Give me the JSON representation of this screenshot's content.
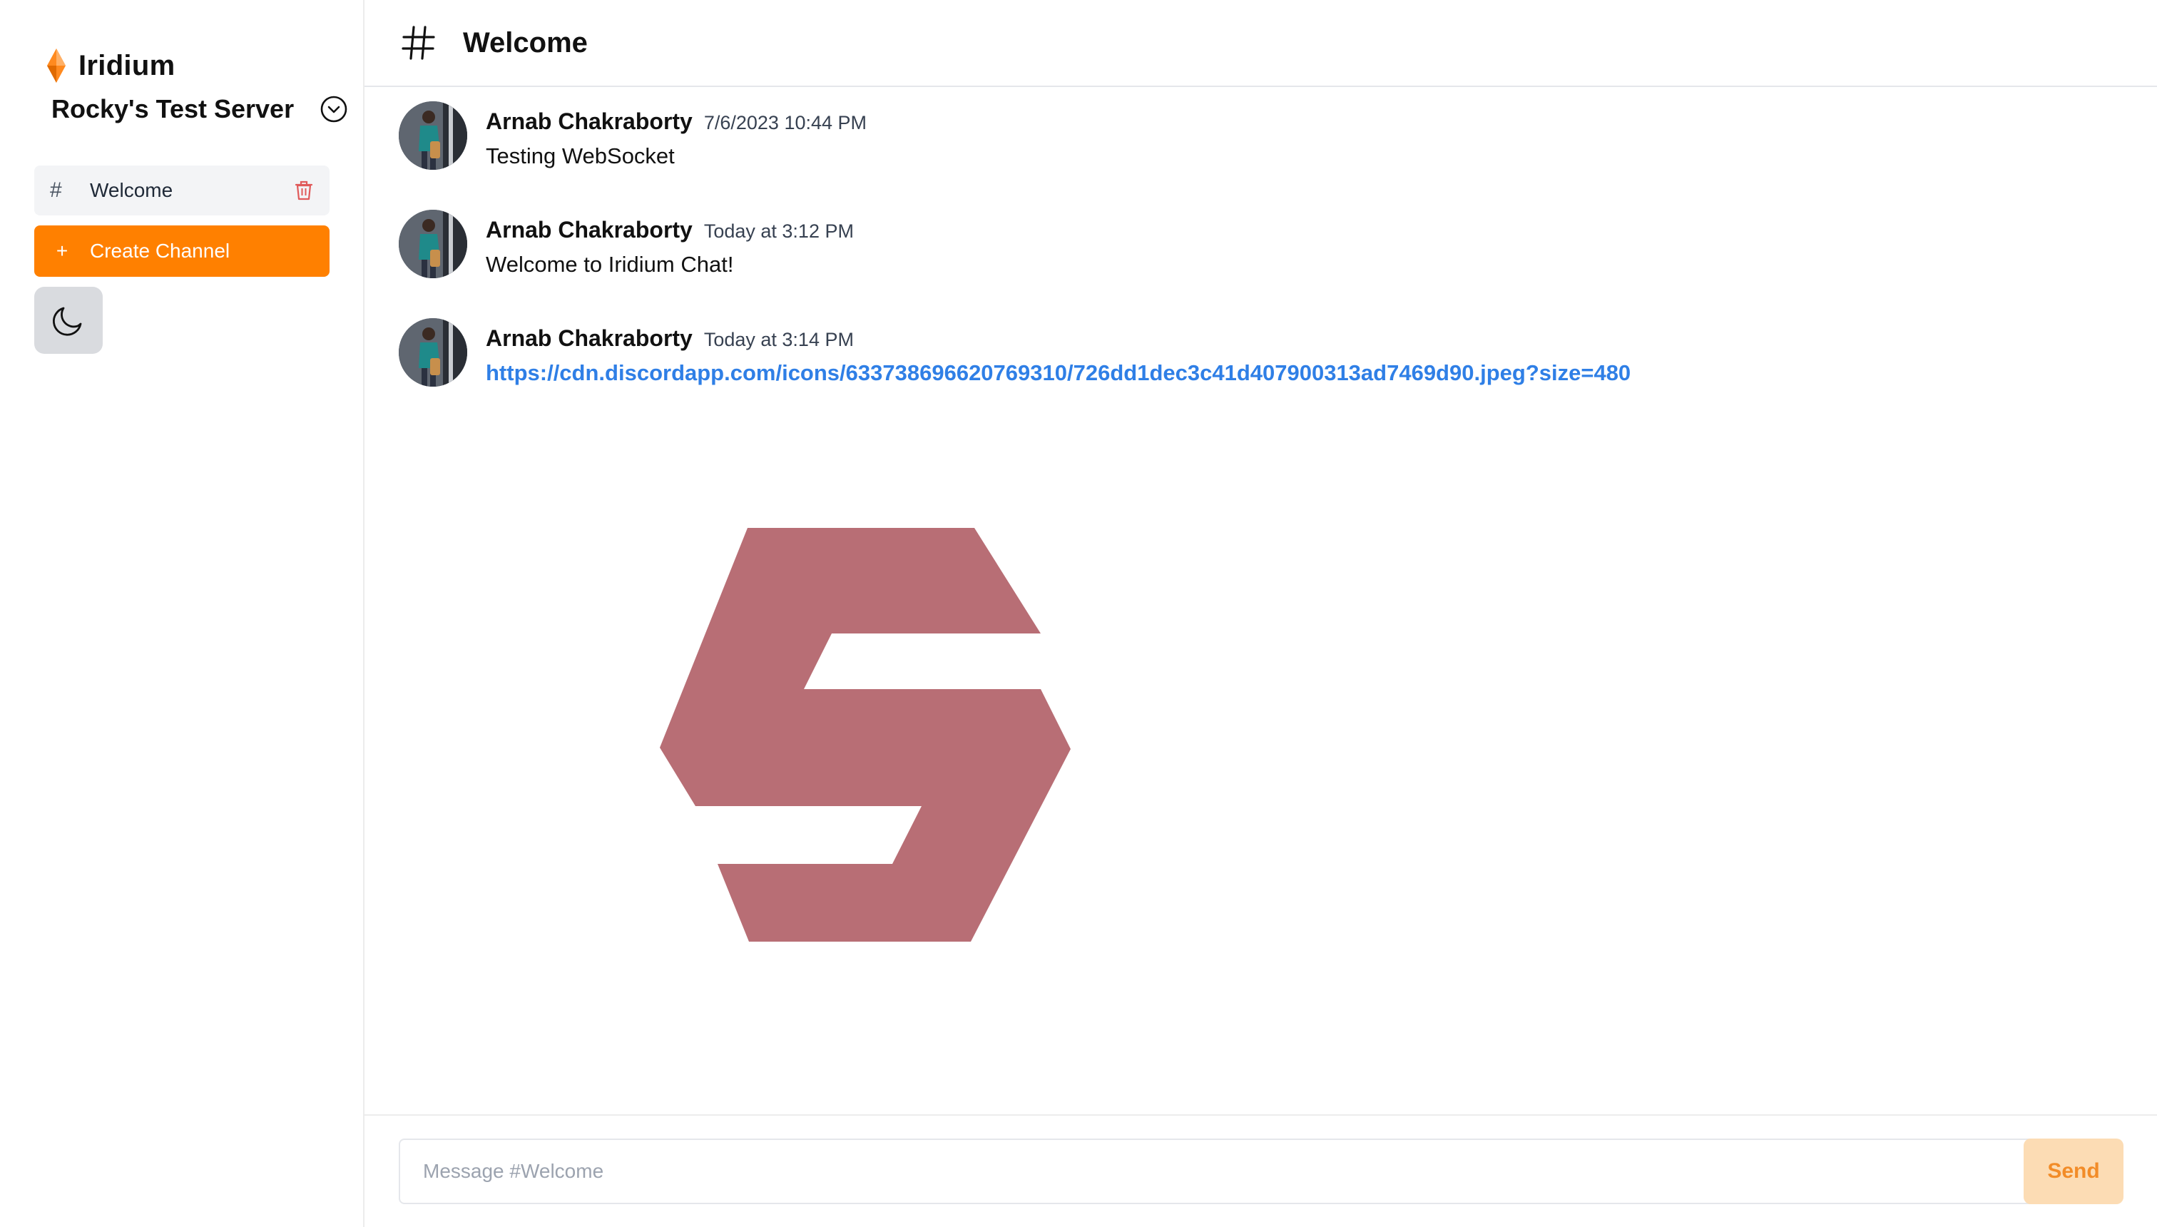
{
  "app": {
    "name": "Iridium",
    "brand_color": "#ff8000"
  },
  "sidebar": {
    "server_name": "Rocky's Test Server",
    "channels": [
      {
        "hash": "#",
        "label": "Welcome",
        "selected": true
      }
    ],
    "create_channel": {
      "icon": "+",
      "label": "Create Channel"
    },
    "theme_toggle_icon": "moon-icon"
  },
  "header": {
    "icon": "hash-icon",
    "title": "Welcome"
  },
  "messages": [
    {
      "author": "Arnab Chakraborty",
      "time": "7/6/2023 10:44 PM",
      "text": "Testing WebSocket"
    },
    {
      "author": "Arnab Chakraborty",
      "time": "Today at 3:12 PM",
      "text": "Welcome to Iridium Chat!"
    },
    {
      "author": "Arnab Chakraborty",
      "time": "Today at 3:14 PM",
      "link": "https://cdn.discordapp.com/icons/633738696620769310/726dd1dec3c41d407900313ad7469d90.jpeg?size=480"
    }
  ],
  "embed": {
    "logo_color": "#b86e75"
  },
  "composer": {
    "placeholder": "Message #Welcome",
    "value": "",
    "send_label": "Send"
  },
  "colors": {
    "link": "#2f7fe6",
    "send_bg": "#fcdcb4",
    "send_text": "#f28c28",
    "trash": "#e05a5a"
  }
}
